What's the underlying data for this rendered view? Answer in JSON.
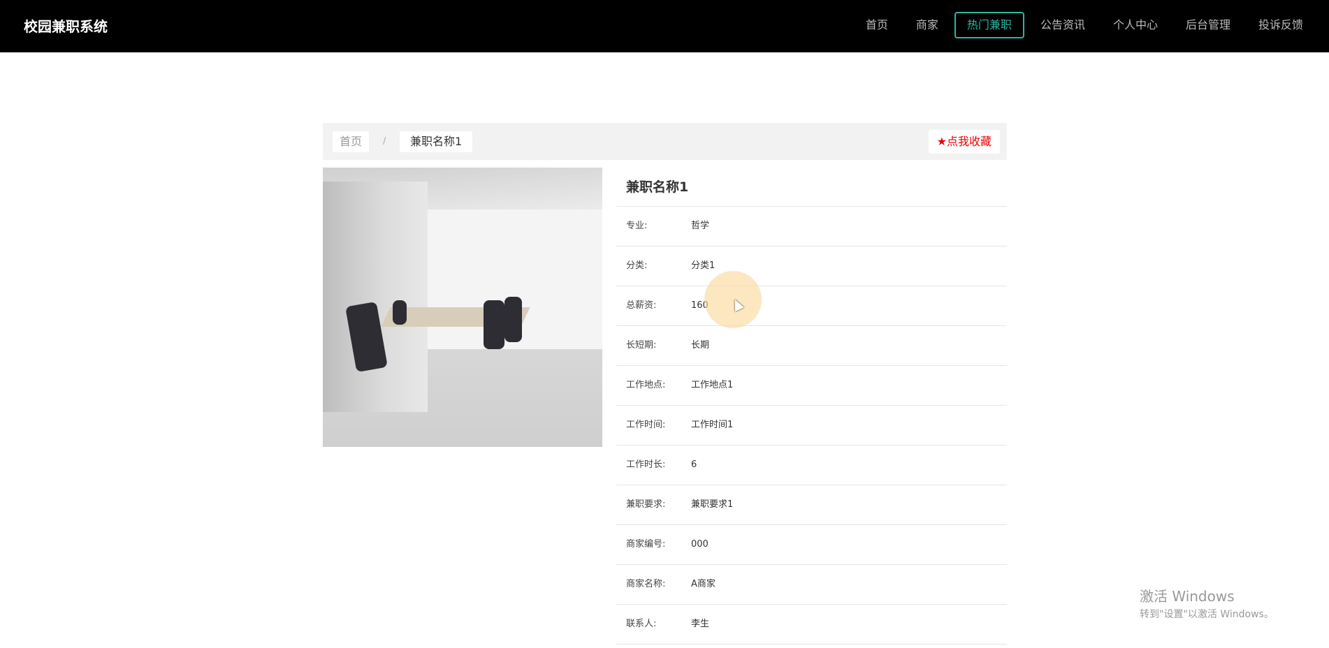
{
  "header": {
    "logo": "校园兼职系统",
    "nav": [
      {
        "label": "首页"
      },
      {
        "label": "商家"
      },
      {
        "label": "热门兼职",
        "active": true
      },
      {
        "label": "公告资讯"
      },
      {
        "label": "个人中心"
      },
      {
        "label": "后台管理"
      },
      {
        "label": "投诉反馈"
      }
    ],
    "active_color": "#2bb8a0"
  },
  "breadcrumb": {
    "home": "首页",
    "separator": "/",
    "current": "兼职名称1"
  },
  "favorite": {
    "icon": "star-icon",
    "label": "点我收藏",
    "color": "#e00000"
  },
  "detail": {
    "title": "兼职名称1",
    "rows": [
      {
        "label": "专业:",
        "value": "哲学"
      },
      {
        "label": "分类:",
        "value": "分类1"
      },
      {
        "label": "总薪资:",
        "value": "160"
      },
      {
        "label": "长短期:",
        "value": "长期"
      },
      {
        "label": "工作地点:",
        "value": "工作地点1"
      },
      {
        "label": "工作时间:",
        "value": "工作时间1"
      },
      {
        "label": "工作时长:",
        "value": "6"
      },
      {
        "label": "兼职要求:",
        "value": "兼职要求1"
      },
      {
        "label": "商家编号:",
        "value": "000"
      },
      {
        "label": "商家名称:",
        "value": "A商家"
      },
      {
        "label": "联系人:",
        "value": "李生"
      }
    ]
  },
  "watermark": {
    "line1": "激活 Windows",
    "line2": "转到\"设置\"以激活 Windows。"
  }
}
